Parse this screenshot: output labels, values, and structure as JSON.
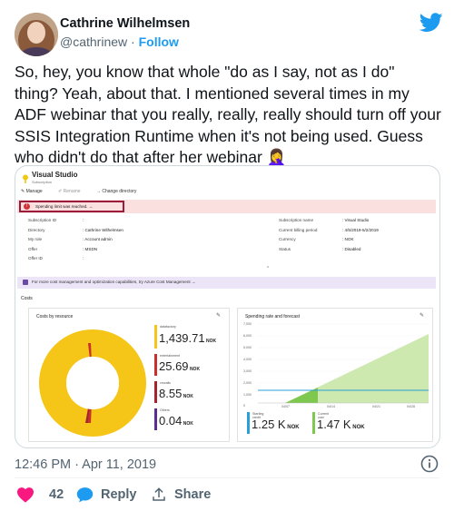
{
  "tweet": {
    "author_name": "Cathrine Wilhelmsen",
    "handle": "@cathrinew",
    "separator": " · ",
    "follow_label": "Follow",
    "text": "So, hey, you know that whole \"do as I say, not as I do\" thing? Yeah, about that. I mentioned several times in my ADF webinar that you really, really, really should turn off your SSIS Integration Runtime when it's not being used. Guess who didn't do that after her webinar 🤦‍♀️",
    "timestamp": "12:46 PM · Apr 11, 2019",
    "likes_count": "42",
    "reply_label": "Reply",
    "share_label": "Share"
  },
  "azure": {
    "title": "Visual Studio",
    "subtitle": "Subscription",
    "toolbar": [
      "Manage",
      "Rename",
      "Change directory"
    ],
    "alert": "Spending limit was reached.",
    "left_labels": [
      "Subscription ID",
      "Directory",
      "My role",
      "Offer",
      "Offer ID"
    ],
    "left_values": [
      ":",
      ": Cathrine Wilhelmsen",
      ": Account admin",
      ": MSDN",
      ":"
    ],
    "right_labels": [
      "Subscription name",
      "Current billing period",
      "Currency",
      "Status"
    ],
    "right_values": [
      ": Visual Studio",
      ": 4/5/2019-5/2/2019",
      ": NOK",
      ": Disabled"
    ],
    "promo": "For more cost management and optimization capabilities, try Azure Cost Management",
    "costs_label": "Costs",
    "costs_by_resource_title": "Costs by resource",
    "resources": [
      {
        "name": "datafactory",
        "value": "1,439.71",
        "unit": "NOK",
        "color": "#f5c518"
      },
      {
        "name": "entertainment",
        "value": "25.69",
        "unit": "NOK",
        "color": "#c9302c"
      },
      {
        "name": "vmcalls",
        "value": "8.55",
        "unit": "NOK",
        "color": "#a4262c"
      },
      {
        "name": "Others",
        "value": "0.04",
        "unit": "NOK",
        "color": "#5c2d91"
      }
    ],
    "spending_title": "Spending rate and forecast",
    "y_ticks": [
      "7,000",
      "6,000",
      "5,000",
      "4,000",
      "3,000",
      "2,000",
      "1,000",
      "0"
    ],
    "x_ticks": [
      "04/07",
      "04/14",
      "04/21",
      "04/28"
    ],
    "starting_credit_label": "Starting credit",
    "starting_credit_value": "1.25 K",
    "current_cost_label": "Current cost",
    "current_cost_value": "1.47 K",
    "currency_unit": "NOK",
    "colors": {
      "teal": "#2aa0d9",
      "green": "#7ec850",
      "alert_border": "#9c1b3b"
    }
  }
}
